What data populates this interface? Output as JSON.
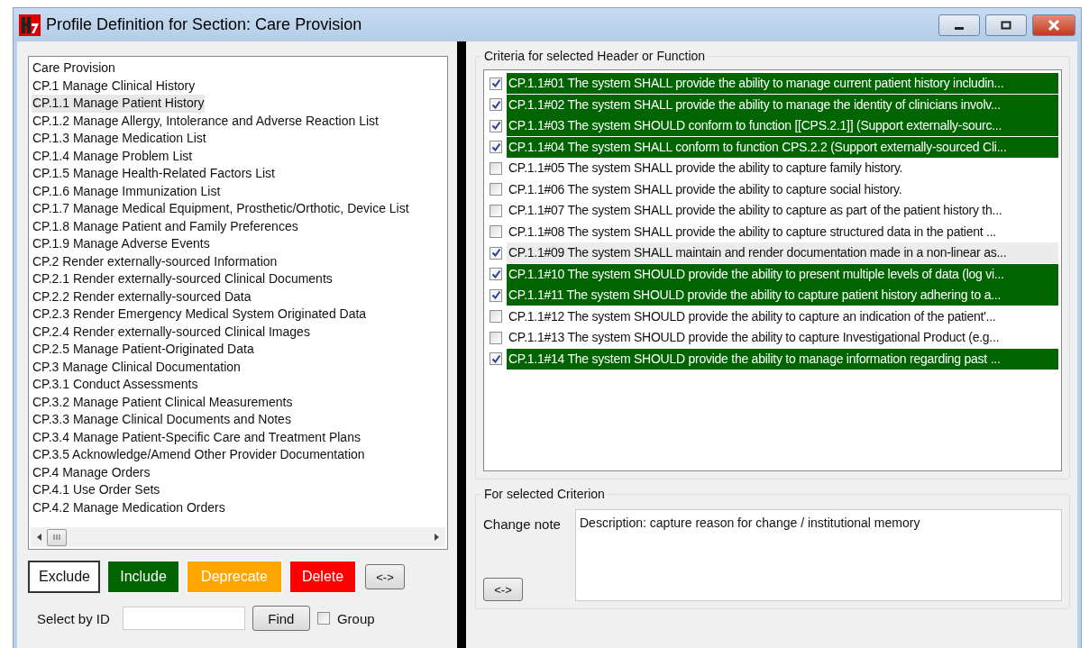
{
  "window": {
    "title": "Profile Definition for Section: Care Provision"
  },
  "sections": [
    {
      "label": "Care Provision",
      "selected": false
    },
    {
      "label": "CP.1 Manage Clinical History",
      "selected": false
    },
    {
      "label": "CP.1.1 Manage Patient History",
      "selected": true
    },
    {
      "label": "CP.1.2 Manage Allergy, Intolerance and Adverse Reaction List",
      "selected": false
    },
    {
      "label": "CP.1.3 Manage Medication List",
      "selected": false
    },
    {
      "label": "CP.1.4 Manage Problem List",
      "selected": false
    },
    {
      "label": "CP.1.5 Manage Health-Related Factors List",
      "selected": false
    },
    {
      "label": "CP.1.6 Manage Immunization List",
      "selected": false
    },
    {
      "label": "CP.1.7 Manage Medical Equipment, Prosthetic/Orthotic, Device List",
      "selected": false
    },
    {
      "label": "CP.1.8 Manage Patient and Family Preferences",
      "selected": false
    },
    {
      "label": "CP.1.9 Manage Adverse Events",
      "selected": false
    },
    {
      "label": "CP.2 Render externally-sourced Information",
      "selected": false
    },
    {
      "label": "CP.2.1 Render externally-sourced Clinical Documents",
      "selected": false
    },
    {
      "label": "CP.2.2 Render externally-sourced Data",
      "selected": false
    },
    {
      "label": "CP.2.3 Render Emergency Medical System Originated Data",
      "selected": false
    },
    {
      "label": "CP.2.4 Render externally-sourced Clinical Images",
      "selected": false
    },
    {
      "label": "CP.2.5 Manage Patient-Originated Data",
      "selected": false
    },
    {
      "label": "CP.3 Manage Clinical Documentation",
      "selected": false
    },
    {
      "label": "CP.3.1 Conduct Assessments",
      "selected": false
    },
    {
      "label": "CP.3.2 Manage Patient Clinical Measurements",
      "selected": false
    },
    {
      "label": "CP.3.3 Manage Clinical Documents and Notes",
      "selected": false
    },
    {
      "label": "CP.3.4 Manage Patient-Specific Care and Treatment Plans",
      "selected": false
    },
    {
      "label": "CP.3.5 Acknowledge/Amend Other Provider Documentation",
      "selected": false
    },
    {
      "label": "CP.4 Manage Orders",
      "selected": false
    },
    {
      "label": "CP.4.1 Use Order Sets",
      "selected": false
    },
    {
      "label": "CP.4.2 Manage Medication Orders",
      "selected": false
    }
  ],
  "action_buttons": [
    {
      "label": "Exclude",
      "kind": "exclude"
    },
    {
      "label": "Include",
      "kind": "include"
    },
    {
      "label": "Deprecate",
      "kind": "deprecate"
    },
    {
      "label": "Delete",
      "kind": "delete"
    },
    {
      "label": "<->",
      "kind": "plain"
    }
  ],
  "select_by_id": {
    "label": "Select by ID",
    "find_button": "Find",
    "group_label": "Group",
    "group_checked": false
  },
  "criteria_group": {
    "title": "Criteria for selected Header or Function"
  },
  "criteria": [
    {
      "text": "CP.1.1#01 The system SHALL provide the ability to manage current patient history includin...",
      "checked": true,
      "included": true,
      "selected": false
    },
    {
      "text": "CP.1.1#02 The system SHALL provide the ability to manage the identity of clinicians involv...",
      "checked": true,
      "included": true,
      "selected": false
    },
    {
      "text": "CP.1.1#03 The system SHOULD conform to function [[CPS.2.1]] (Support externally-sourc...",
      "checked": true,
      "included": true,
      "selected": false
    },
    {
      "text": "CP.1.1#04 The system SHALL conform to function CPS.2.2 (Support externally-sourced Cli...",
      "checked": true,
      "included": true,
      "selected": false
    },
    {
      "text": "CP.1.1#05 The system SHALL provide the ability to capture family history.",
      "checked": false,
      "included": false,
      "selected": false
    },
    {
      "text": "CP.1.1#06 The system SHALL provide the ability to capture social history.",
      "checked": false,
      "included": false,
      "selected": false
    },
    {
      "text": "CP.1.1#07 The system SHALL provide the ability to capture as part of the patient history th...",
      "checked": false,
      "included": false,
      "selected": false
    },
    {
      "text": "CP.1.1#08 The system SHALL provide the ability to capture structured data in the patient ...",
      "checked": false,
      "included": false,
      "selected": false
    },
    {
      "text": "CP.1.1#09 The system SHALL maintain and render documentation made in a non-linear as...",
      "checked": true,
      "included": false,
      "selected": true
    },
    {
      "text": "CP.1.1#10 The system SHOULD provide the ability to present multiple levels of data (log vi...",
      "checked": true,
      "included": true,
      "selected": false
    },
    {
      "text": "CP.1.1#11 The system SHOULD provide the ability to capture patient history adhering to a...",
      "checked": true,
      "included": true,
      "selected": false
    },
    {
      "text": "CP.1.1#12 The system SHOULD provide the ability to capture an indication of the patient'...",
      "checked": false,
      "included": false,
      "selected": false
    },
    {
      "text": "CP.1.1#13 The system SHOULD provide the ability to capture Investigational Product (e.g...",
      "checked": false,
      "included": false,
      "selected": false
    },
    {
      "text": "CP.1.1#14 The system SHOULD provide the ability to manage information regarding past ...",
      "checked": true,
      "included": true,
      "selected": false
    }
  ],
  "criterion_group": {
    "title": "For selected Criterion",
    "change_note_label": "Change note",
    "change_note": "Description: capture reason for change / institutional memory",
    "swap_button": "<->"
  }
}
